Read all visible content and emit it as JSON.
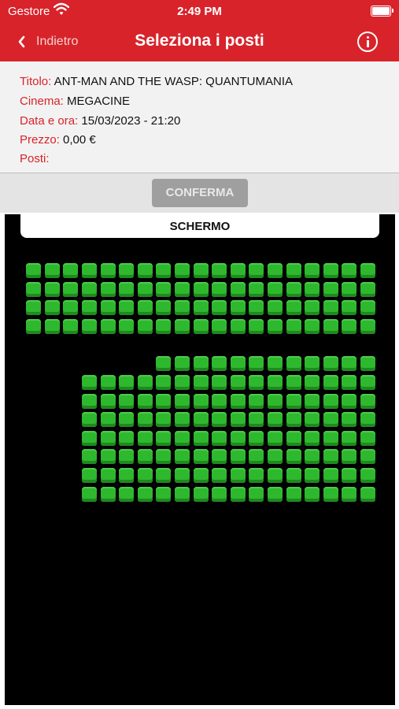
{
  "status_bar": {
    "carrier": "Gestore",
    "time": "2:49 PM"
  },
  "nav": {
    "back_label": "Indietro",
    "title": "Seleziona i posti"
  },
  "details": {
    "title_label": "Titolo:",
    "title_value": "ANT-MAN AND THE WASP: QUANTUMANIA",
    "cinema_label": "Cinema:",
    "cinema_value": "MEGACINE",
    "datetime_label": "Data e ora:",
    "datetime_value": "15/03/2023 - 21:20",
    "price_label": "Prezzo:",
    "price_value": "0,00 €",
    "seats_label": "Posti:",
    "seats_value": ""
  },
  "confirm_label": "CONFERMA",
  "screen_label": "SCHERMO",
  "colors": {
    "brand_red": "#d8232a",
    "seat_available": "#2eb82e",
    "hall_background": "#000000"
  },
  "seat_map": {
    "seat_status": "available",
    "blocks": [
      {
        "rows": 4,
        "seats_per_row": 19
      },
      {
        "rows": 1,
        "seats_per_row": 12
      },
      {
        "rows": 7,
        "seats_per_row": 16
      }
    ]
  }
}
